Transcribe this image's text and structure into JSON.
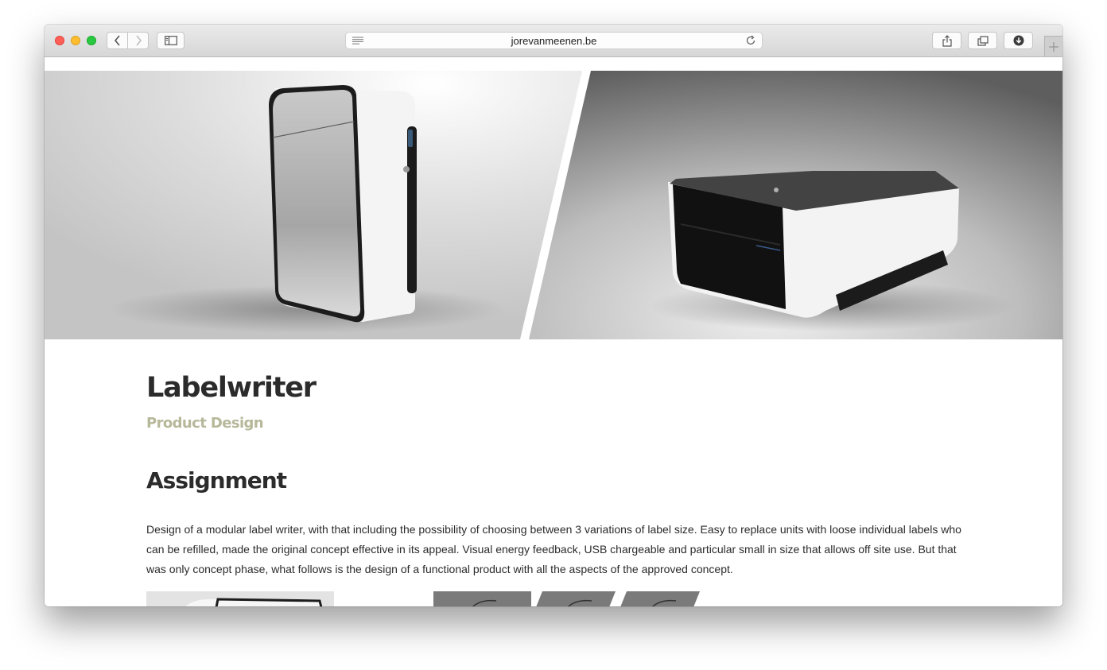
{
  "browser": {
    "url": "jorevanmeenen.be",
    "icons": [
      "back-icon",
      "forward-icon",
      "sidebar-icon",
      "reader-icon",
      "reload-icon",
      "share-icon",
      "tabs-icon",
      "download-icon",
      "new-tab-icon"
    ]
  },
  "page": {
    "title": "Labelwriter",
    "subtitle": "Product Design",
    "section_heading": "Assignment",
    "body": "Design of a modular label writer, with that including the possibility of choosing between 3 variations of label size. Easy to replace units with loose individual labels who can be refilled, made the original concept effective in its appeal. Visual energy feedback, USB chargeable and particular small in size that allows off site use. But that was only concept phase, what follows is the design of a functional product with all the aspects of the approved concept."
  },
  "colors": {
    "title": "#2b2b2b",
    "subtitle": "#b7b89a",
    "text": "#2b2b2b"
  }
}
